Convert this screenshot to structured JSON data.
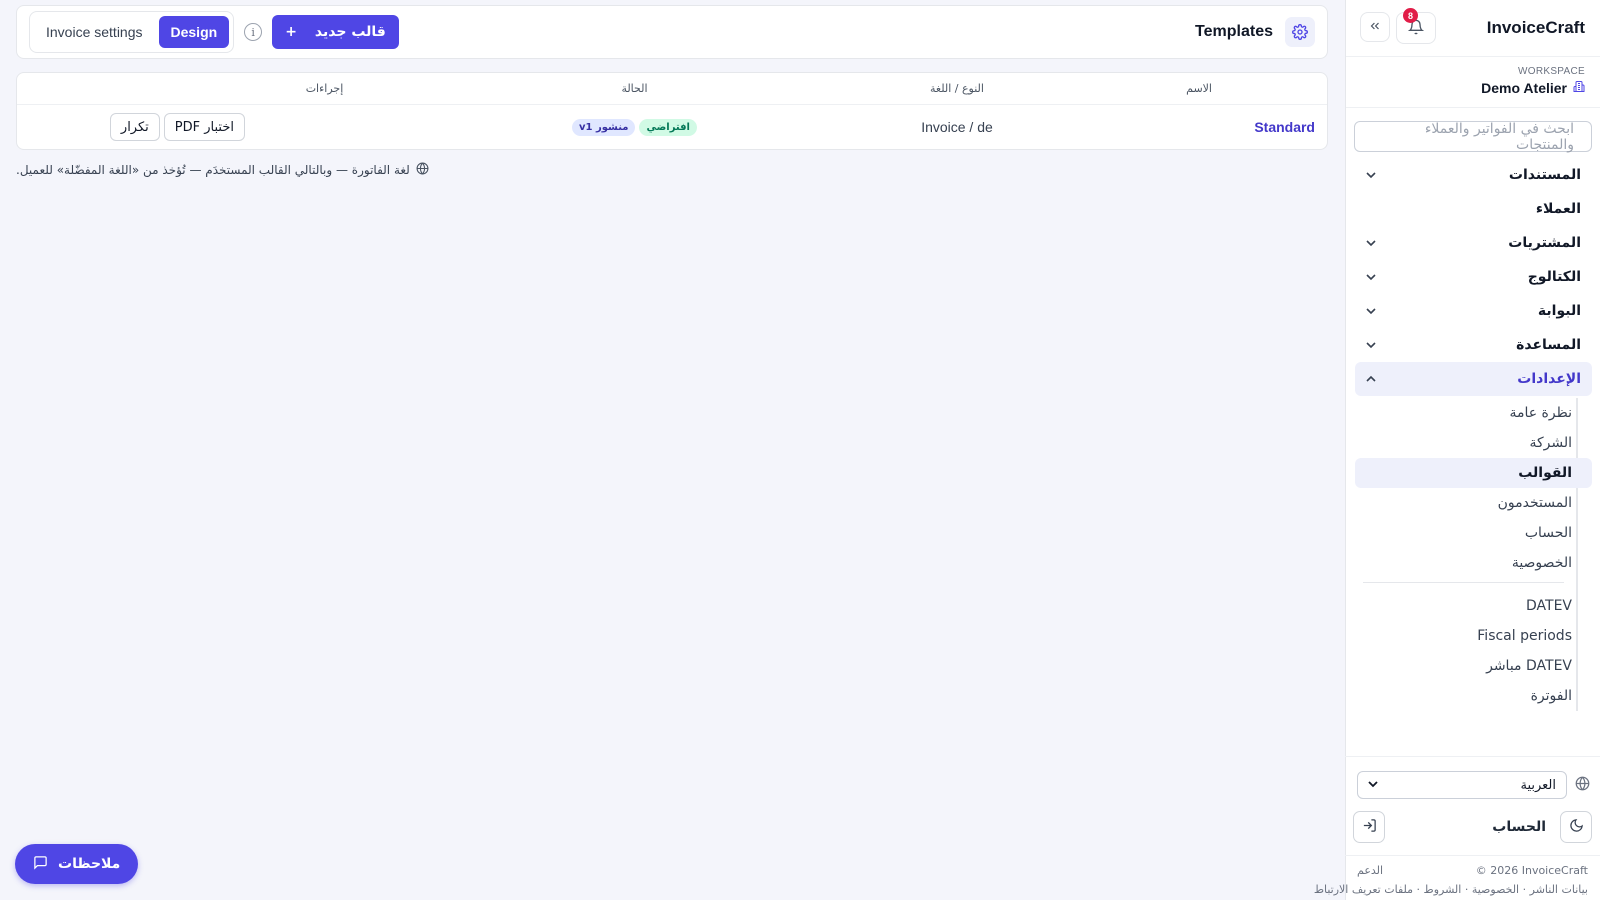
{
  "sidebar": {
    "brand": "InvoiceCraft",
    "notifications_count": "8",
    "workspace_label": "WORKSPACE",
    "workspace_name": "Demo Atelier",
    "search_placeholder": "ابحث في الفواتير والعملاء والمنتجات",
    "nav": [
      {
        "label": "المستندات",
        "expandable": true
      },
      {
        "label": "العملاء",
        "expandable": false
      },
      {
        "label": "المشتريات",
        "expandable": true
      },
      {
        "label": "الكتالوج",
        "expandable": true
      },
      {
        "label": "البوابة",
        "expandable": true
      },
      {
        "label": "المساعدة",
        "expandable": true
      },
      {
        "label": "الإعدادات",
        "expandable": true,
        "expanded": true
      }
    ],
    "settings_sub": [
      "نظرة عامة",
      "الشركة",
      "القوالب",
      "المستخدمون",
      "الحساب",
      "الخصوصية"
    ],
    "settings_sub2": [
      "DATEV",
      "Fiscal periods",
      "DATEV مباشر",
      "الفوترة"
    ],
    "language_value": "العربية",
    "account_label": "الحساب",
    "footer_copyright": "© 2026 InvoiceCraft",
    "footer_support": "الدعم",
    "footer_links": [
      "بيانات الناشر",
      "الخصوصية",
      "الشروط",
      "ملفات تعريف الارتباط"
    ]
  },
  "header": {
    "title": "Templates",
    "new_template_label": "قالب جديد",
    "new_template_plus": "+",
    "tab_invoice_settings": "Invoice settings",
    "tab_design": "Design",
    "info_glyph": "i"
  },
  "table": {
    "columns": {
      "name": "الاسم",
      "type_lang": "النوع / اللغة",
      "status": "الحالة",
      "actions": "إجراءات"
    },
    "rows": [
      {
        "name": "Standard",
        "type_lang": "Invoice / de",
        "badge_default": "افتراضي",
        "badge_published": "منشور v1",
        "action_test_pdf": "اختبار PDF",
        "action_duplicate": "تكرار"
      }
    ]
  },
  "hint": "لغة الفاتورة — وبالتالي القالب المستخدَم — تُؤخذ من «اللغة المفضّلة» للعميل.",
  "feedback_label": "ملاحظات",
  "colors": {
    "accent": "#4f46e5",
    "background": "#f4f5fb",
    "badge_green_bg": "#d1fae5",
    "badge_indigo_bg": "#e0e7ff"
  }
}
